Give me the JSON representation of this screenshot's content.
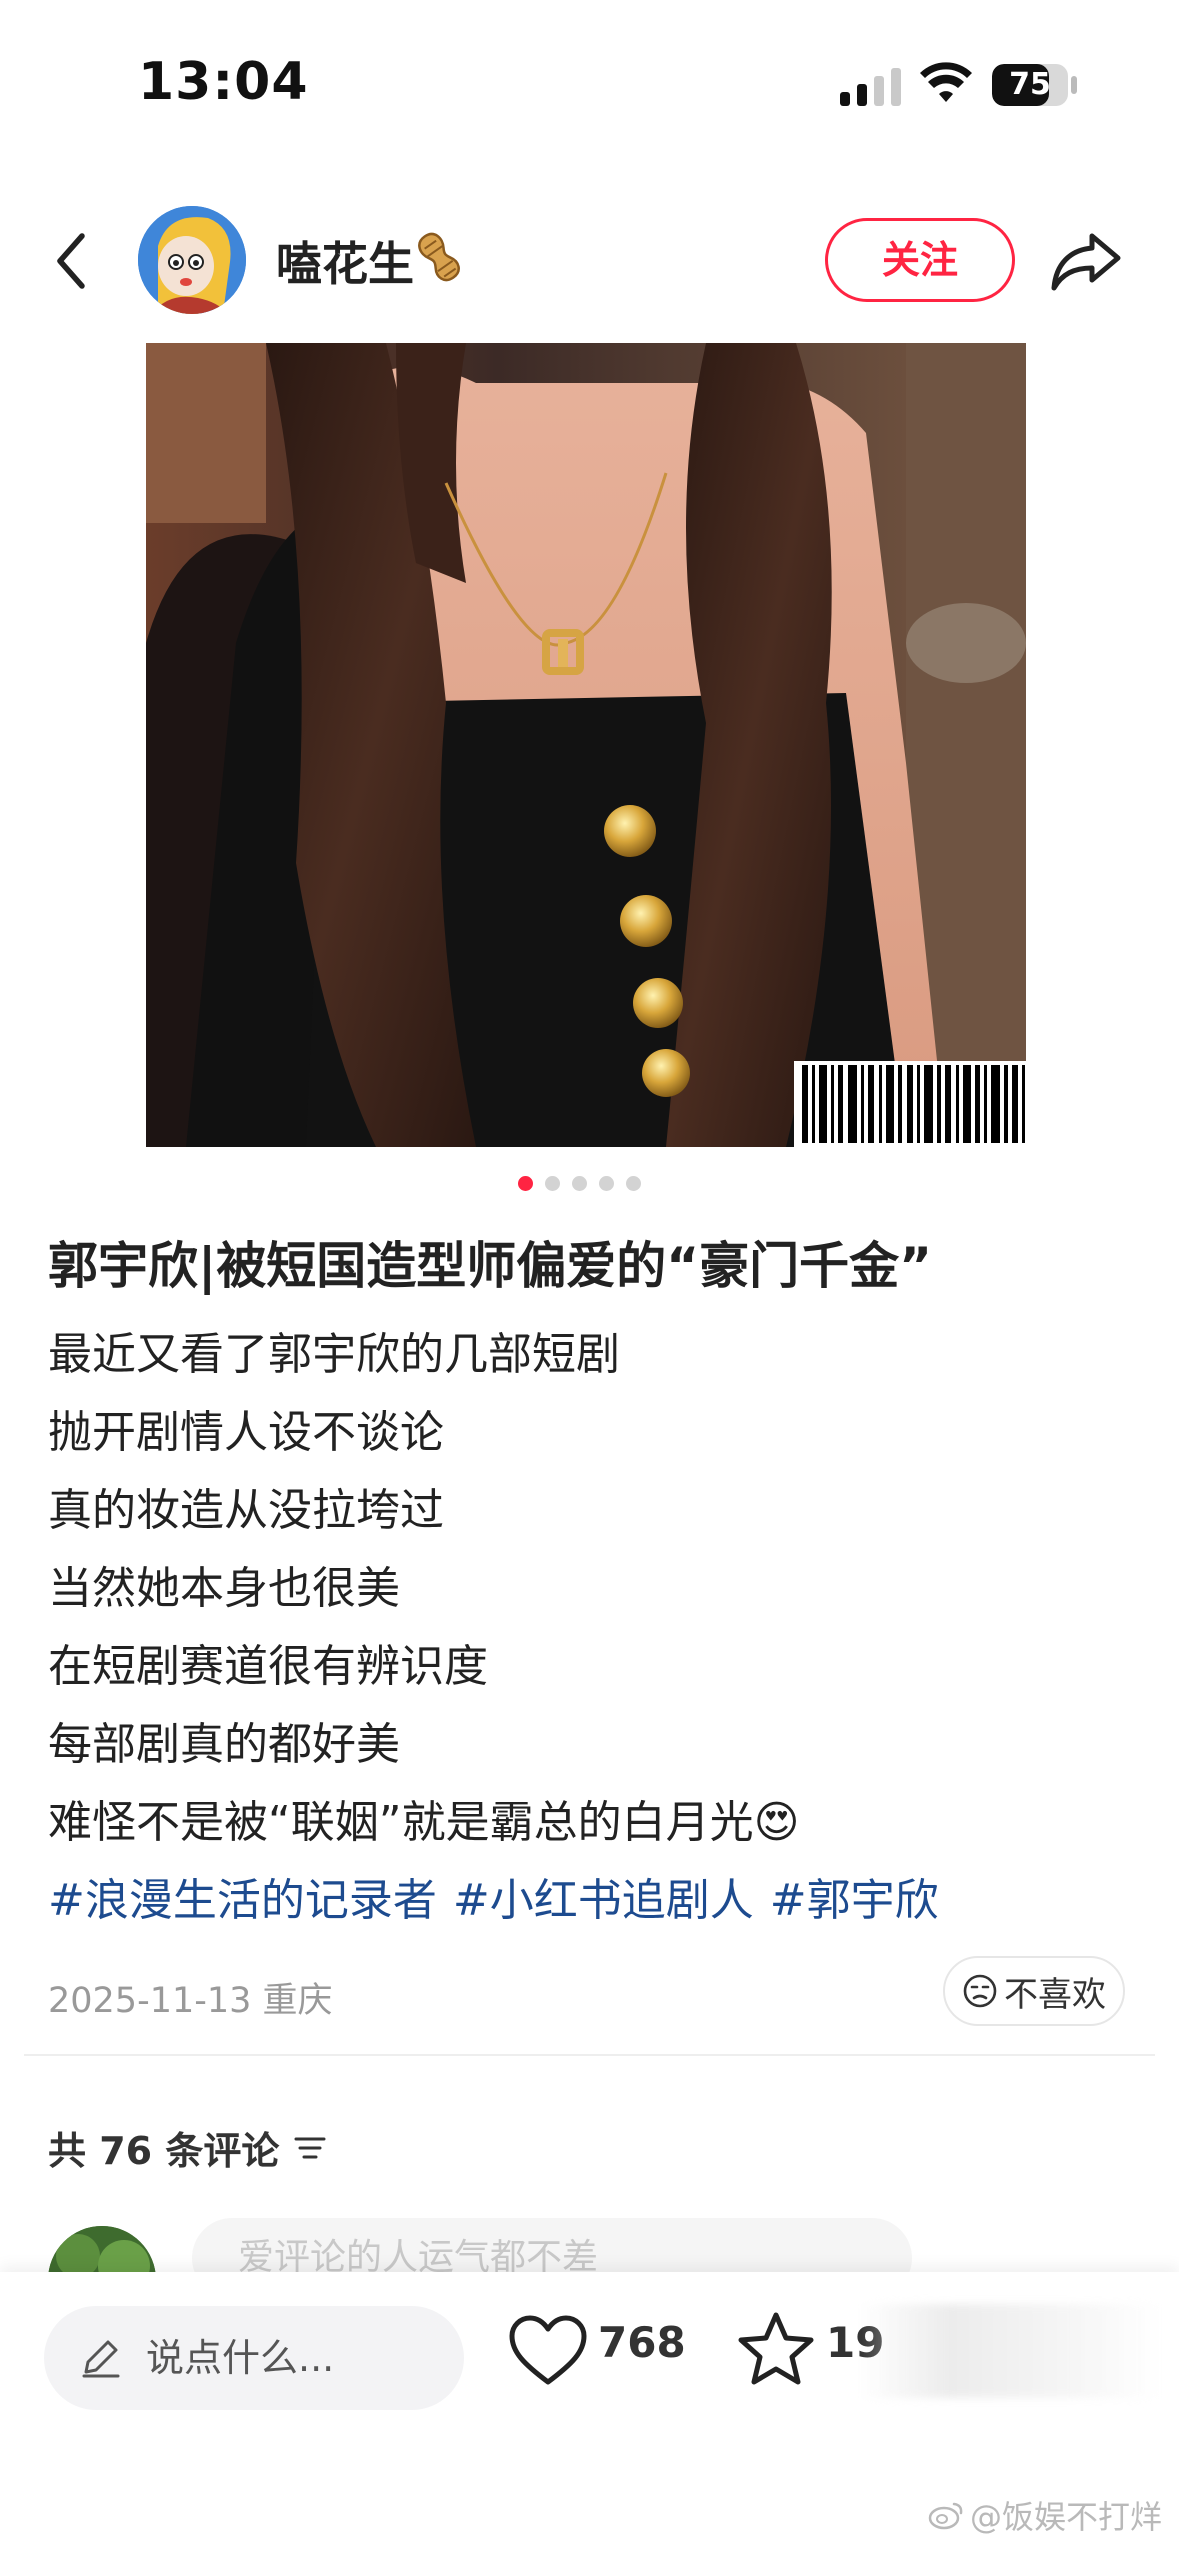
{
  "status_bar": {
    "time": "13:04",
    "battery_level": "75",
    "battery_fraction": 0.75
  },
  "header": {
    "author_name": "嗑花生",
    "follow_label": "关注"
  },
  "carousel": {
    "total_images": 5,
    "current_index": 0
  },
  "post": {
    "title": "郭宇欣|被短国造型师偏爱的“豪门千金”",
    "lines": [
      "最近又看了郭宇欣的几部短剧",
      "抛开剧情人设不谈论",
      "真的妆造从没拉垮过",
      "当然她本身也很美",
      "在短剧赛道很有辨识度",
      "每部剧真的都好美",
      "难怪不是被“联姻”就是霸总的白月光😍"
    ],
    "hashtags": [
      "#浪漫生活的记录者",
      "#小红书追剧人",
      "#郭宇欣"
    ],
    "date_location": "2025-11-13 重庆",
    "dislike_label": "不喜欢"
  },
  "comments": {
    "count_label": "共 76 条评论",
    "preview_text": "爱评论的人运气都不差"
  },
  "bottom_bar": {
    "input_placeholder": "说点什么...",
    "like_count": "768",
    "collect_count": "19"
  },
  "watermark": "@饭娱不打烊",
  "colors": {
    "accent": "#ff2442",
    "hashtag": "#1d4b8f"
  }
}
